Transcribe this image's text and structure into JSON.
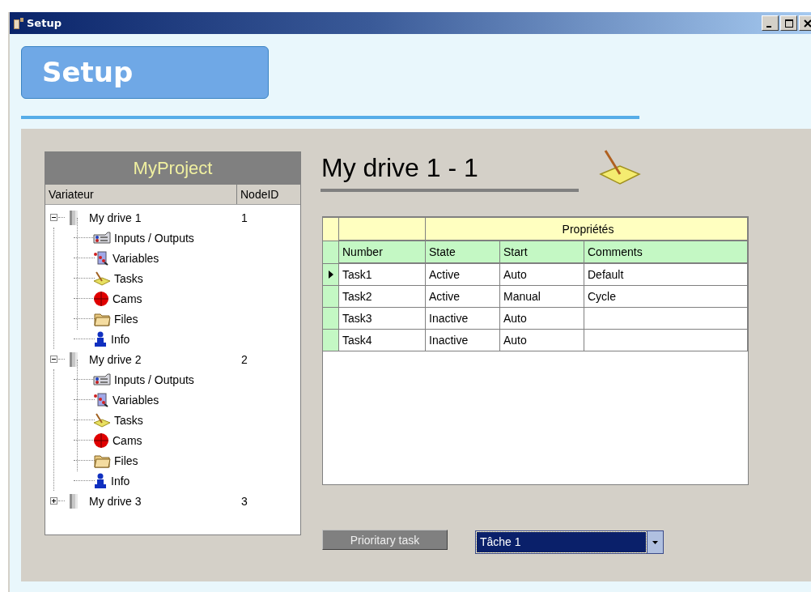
{
  "window": {
    "title": "Setup"
  },
  "header": {
    "title": "Setup"
  },
  "tree": {
    "title": "MyProject",
    "columns": [
      "Variateur",
      "NodeID"
    ],
    "nodes": [
      {
        "label": "My drive 1",
        "node_id": "1",
        "expanded": true,
        "children": [
          {
            "label": "Inputs / Outputs",
            "kind": "io"
          },
          {
            "label": "Variables",
            "kind": "variables"
          },
          {
            "label": "Tasks",
            "kind": "tasks"
          },
          {
            "label": "Cams",
            "kind": "cams"
          },
          {
            "label": "Files",
            "kind": "files"
          },
          {
            "label": "Info",
            "kind": "info"
          }
        ]
      },
      {
        "label": "My drive 2",
        "node_id": "2",
        "expanded": true,
        "children": [
          {
            "label": "Inputs / Outputs",
            "kind": "io"
          },
          {
            "label": "Variables",
            "kind": "variables"
          },
          {
            "label": "Tasks",
            "kind": "tasks"
          },
          {
            "label": "Cams",
            "kind": "cams"
          },
          {
            "label": "Files",
            "kind": "files"
          },
          {
            "label": "Info",
            "kind": "info"
          }
        ]
      },
      {
        "label": "My drive 3",
        "node_id": "3",
        "expanded": false
      }
    ]
  },
  "detail": {
    "title": "My drive 1 - 1"
  },
  "table": {
    "group_header": "Propriétés",
    "columns": [
      "Number",
      "State",
      "Start",
      "Comments"
    ],
    "rows": [
      {
        "selected": true,
        "cells": [
          "Task1",
          "Active",
          "Auto",
          "Default"
        ]
      },
      {
        "selected": false,
        "cells": [
          "Task2",
          "Active",
          "Manual",
          "Cycle"
        ]
      },
      {
        "selected": false,
        "cells": [
          "Task3",
          "Inactive",
          "Auto",
          ""
        ]
      },
      {
        "selected": false,
        "cells": [
          "Task4",
          "Inactive",
          "Auto",
          ""
        ]
      }
    ]
  },
  "priority": {
    "button": "Prioritary task",
    "value": "Tâche 1"
  }
}
